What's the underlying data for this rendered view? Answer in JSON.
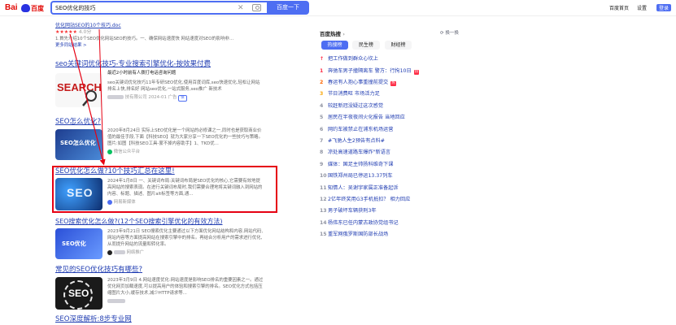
{
  "header": {
    "logo_bai": "Bai",
    "logo_du": "百度",
    "query": "SEO优化的技巧",
    "search_button": "百度一下",
    "links": [
      "百度首页",
      "设置",
      "登录"
    ]
  },
  "results": [
    {
      "title_lines": [
        "优化网站SEO的10个技巧.doc"
      ],
      "stars": "★★★★★",
      "score": "4.0分",
      "snippet": "1.首先介绍10个SEO优化网站SEO的技巧。一、确保网站速度快 网站速度对SEO的影响非...",
      "more": "更多同站结果 >"
    },
    {
      "title": "seo关键词优化技巧-专业搜索引擎优化-按效果付费",
      "sub": "最近2小时前有人拨打电话咨询问题",
      "thumb_text": "SEARCH",
      "snippet": "seo关键词优化技巧11年专研SEO优化,使用百度词库,seo快速优化,轻松让网站排名上快,排名好 网站seo优化,一站式服务,seo推广 新技术",
      "meta": "技有限公司 2024-01",
      "ad": "广告",
      "badge": "保"
    },
    {
      "title": "SEO怎么优化?",
      "snippet": "2020年8月24日 实际上SEO优化是一个网站的必修课之一,同时也是获取商业价值的最佳手段,下面【科技SEO】就为大家分享一下SEO优化的一些技巧与策略。图片:如图【科技SEO工具-蒙不掉内容助手】1、TKD优...",
      "meta": "微信公众平台",
      "thumb_text": "SEO怎么优化"
    },
    {
      "title": "SEO优化怎么做?10个技巧汇总在这里!",
      "snippet": "2024年1月8日 一、关键词布局:关键词布局是SEO优化的核心,它需要有效地提高网站的搜索表现。在进行关键词布局时,我们需要合理地将关键词融入到网站的内容、标题、描述、图片alt标签等方面,通...",
      "meta": "网易新媒体",
      "thumb_text": "SEO"
    },
    {
      "title": "SEO搜索优化怎么做?(12个SEO搜索引擎优化的有效方法)",
      "snippet": "2023年9月21日 SEO搜索优化主要通过以下方面优化网站结构和内容,网站代码,网站内容等方面提高网站在搜索引擎中的排名。再结合分析用户的需求进行优化,从而提升网站的流量和转化率。",
      "meta": "网络推广",
      "thumb_text": "SEO优化"
    },
    {
      "title": "常见的SEO优化技巧有哪些?",
      "snippet": "2023年3月9日 4.网站速度优化:网站速度是影响SEO排名的重要因素之一。通过优化网页加载速度,可以提高用户的体验和搜索引擎的排名。SEO优化方式包括压缩图片大小,缓存技术,减少HTTP请求等...",
      "meta": "",
      "thumb_text": "SEO"
    },
    {
      "title": "SEO深度解析:8步专业网"
    }
  ],
  "hot": {
    "title": "百度热搜",
    "refresh": "换一换",
    "tabs": [
      "热搜榜",
      "民生榜",
      "财经榜"
    ],
    "items": [
      {
        "rank": "↑",
        "text": "把工作做到群众心坎上",
        "hot": ""
      },
      {
        "rank": "1",
        "text": "奔驰车男子撞隔离车 警方：行拘10日",
        "hot": "热"
      },
      {
        "rank": "2",
        "text": "春运有人抱心事重撞前提交",
        "hot": "热"
      },
      {
        "rank": "3",
        "text": "节日消费旺 市场活力足",
        "hot": ""
      },
      {
        "rank": "4",
        "text": "较赶新冠没疑过这次感觉",
        "hot": ""
      },
      {
        "rank": "5",
        "text": "居民在半夜夜间火化报告 当地回应",
        "hot": ""
      },
      {
        "rank": "6",
        "text": "网约车被禁止在浦东机场运营",
        "hot": ""
      },
      {
        "rank": "7",
        "text": "#飞驰人生2预告有点料#",
        "hot": ""
      },
      {
        "rank": "8",
        "text": "凉处高速道路车爆炸\"新语言",
        "hot": ""
      },
      {
        "rank": "9",
        "text": "媒体：国足主帅扬科维奇下课",
        "hot": ""
      },
      {
        "rank": "10",
        "text": "国铁郑州局已停运13.37列车",
        "hot": ""
      },
      {
        "rank": "11",
        "text": "知情人：吴谢宇家属正准备起诉",
        "hot": ""
      },
      {
        "rank": "12",
        "text": "2亿年终奖用G3手机抵扣？ 相力回应",
        "hot": ""
      },
      {
        "rank": "13",
        "text": "男子破坏车辆获刑3年",
        "hot": ""
      },
      {
        "rank": "14",
        "text": "杨伟东已任内蒙古政协党组书记",
        "hot": ""
      },
      {
        "rank": "15",
        "text": "重军网俄罗斯国防部长战场",
        "hot": ""
      }
    ]
  },
  "colors": {
    "brand_blue": "#4e6ef2",
    "link": "#2440b3",
    "highlight": "#e60012",
    "red": "#f73131"
  }
}
